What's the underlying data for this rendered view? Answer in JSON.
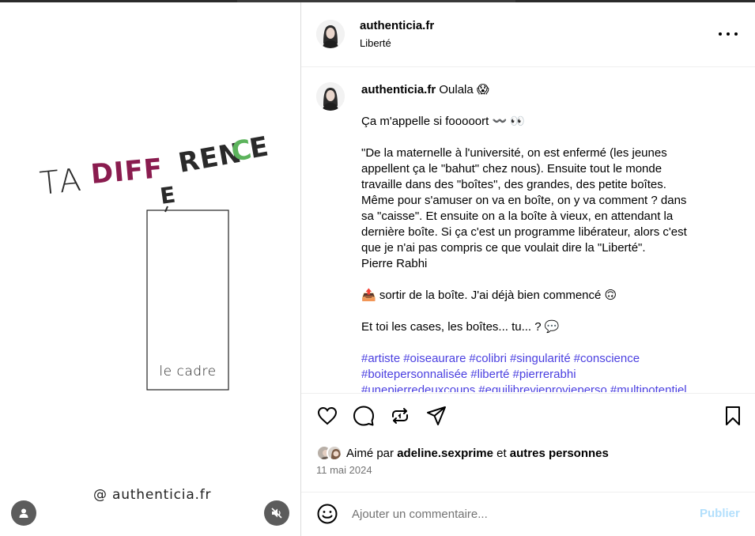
{
  "colors": {
    "hashtag": "#4a3fe0",
    "publish_disabled": "#b2dffc",
    "muted_text": "#737373",
    "art_diff": "#8a1c4f",
    "art_rence": "#2a2a2a",
    "art_accent": "#5cb35c"
  },
  "media": {
    "art": {
      "word_ta": "TA",
      "word_diff": "DIFF",
      "word_e": "E",
      "word_ren": "REN",
      "word_c": "C",
      "word_e2": "E",
      "frame_label": "le cadre",
      "handle": "@ authenticia.fr"
    },
    "tag_icon": "person-icon",
    "mute_icon": "speaker-muted-icon"
  },
  "header": {
    "username": "authenticia.fr",
    "location": "Liberté",
    "more_icon": "more-horizontal-icon"
  },
  "caption": {
    "username": "authenticia.fr",
    "first_line": "Oulala 😱",
    "para1": "Ça m'appelle si fooooort 〰️ 👀",
    "para2_lines": [
      "\"De la maternelle à l'université, on est enfermé (les jeunes",
      "appellent ça le \"bahut\" chez nous). Ensuite tout le monde",
      "travaille dans des \"boîtes\", des grandes, des petite boîtes.",
      "Même pour s'amuser on va en boîte, on y va comment ? dans",
      "sa \"caisse\". Et ensuite on a la boîte à vieux, en attendant la",
      "dernière boîte. Si ça c'est un programme libérateur, alors c'est",
      "que je n'ai pas compris ce que voulait dire la \"Liberté\".",
      "Pierre Rabhi"
    ],
    "para3": "📤 sortir de la boîte. J'ai déjà bien commencé 🙃",
    "para4": "Et toi les cases, les boîtes... tu... ? 💬",
    "hashtags_line1": [
      "#artiste",
      "#oiseaurare",
      "#colibri",
      "#singularité",
      "#conscience"
    ],
    "hashtags_line2": [
      "#boitepersonnalisée",
      "#liberté",
      "#pierrerabhi"
    ],
    "hashtags_line3": [
      "#unepierredeuxcoups",
      "#equilibrevieprovieperso",
      "#multipotentiel"
    ]
  },
  "actions": {
    "like_icon": "heart-icon",
    "comment_icon": "comment-bubble-icon",
    "repost_icon": "repost-icon",
    "share_icon": "paper-plane-icon",
    "save_icon": "bookmark-icon"
  },
  "likes": {
    "prefix": "Aimé par",
    "user": "adeline.sexprime",
    "connector": "et",
    "others": "autres personnes"
  },
  "date": "11 mai 2024",
  "comment": {
    "placeholder": "Ajouter un commentaire...",
    "emoji_icon": "smiley-icon",
    "publish_label": "Publier"
  }
}
